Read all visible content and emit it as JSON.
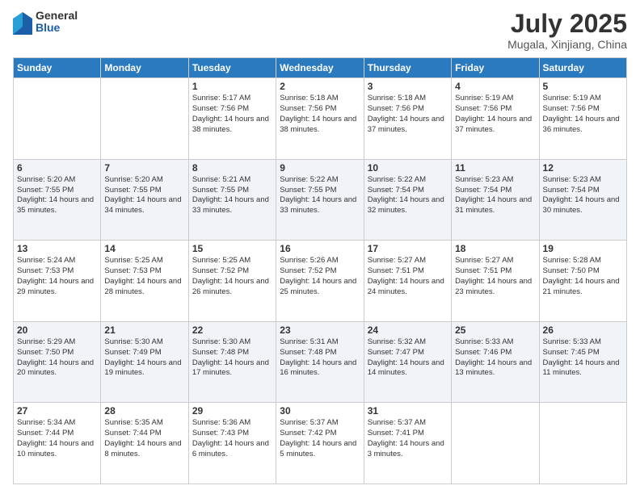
{
  "logo": {
    "general": "General",
    "blue": "Blue"
  },
  "title": "July 2025",
  "location": "Mugala, Xinjiang, China",
  "days": [
    "Sunday",
    "Monday",
    "Tuesday",
    "Wednesday",
    "Thursday",
    "Friday",
    "Saturday"
  ],
  "weeks": [
    [
      {
        "date": "",
        "info": ""
      },
      {
        "date": "",
        "info": ""
      },
      {
        "date": "1",
        "sunrise": "Sunrise: 5:17 AM",
        "sunset": "Sunset: 7:56 PM",
        "daylight": "Daylight: 14 hours and 38 minutes."
      },
      {
        "date": "2",
        "sunrise": "Sunrise: 5:18 AM",
        "sunset": "Sunset: 7:56 PM",
        "daylight": "Daylight: 14 hours and 38 minutes."
      },
      {
        "date": "3",
        "sunrise": "Sunrise: 5:18 AM",
        "sunset": "Sunset: 7:56 PM",
        "daylight": "Daylight: 14 hours and 37 minutes."
      },
      {
        "date": "4",
        "sunrise": "Sunrise: 5:19 AM",
        "sunset": "Sunset: 7:56 PM",
        "daylight": "Daylight: 14 hours and 37 minutes."
      },
      {
        "date": "5",
        "sunrise": "Sunrise: 5:19 AM",
        "sunset": "Sunset: 7:56 PM",
        "daylight": "Daylight: 14 hours and 36 minutes."
      }
    ],
    [
      {
        "date": "6",
        "sunrise": "Sunrise: 5:20 AM",
        "sunset": "Sunset: 7:55 PM",
        "daylight": "Daylight: 14 hours and 35 minutes."
      },
      {
        "date": "7",
        "sunrise": "Sunrise: 5:20 AM",
        "sunset": "Sunset: 7:55 PM",
        "daylight": "Daylight: 14 hours and 34 minutes."
      },
      {
        "date": "8",
        "sunrise": "Sunrise: 5:21 AM",
        "sunset": "Sunset: 7:55 PM",
        "daylight": "Daylight: 14 hours and 33 minutes."
      },
      {
        "date": "9",
        "sunrise": "Sunrise: 5:22 AM",
        "sunset": "Sunset: 7:55 PM",
        "daylight": "Daylight: 14 hours and 33 minutes."
      },
      {
        "date": "10",
        "sunrise": "Sunrise: 5:22 AM",
        "sunset": "Sunset: 7:54 PM",
        "daylight": "Daylight: 14 hours and 32 minutes."
      },
      {
        "date": "11",
        "sunrise": "Sunrise: 5:23 AM",
        "sunset": "Sunset: 7:54 PM",
        "daylight": "Daylight: 14 hours and 31 minutes."
      },
      {
        "date": "12",
        "sunrise": "Sunrise: 5:23 AM",
        "sunset": "Sunset: 7:54 PM",
        "daylight": "Daylight: 14 hours and 30 minutes."
      }
    ],
    [
      {
        "date": "13",
        "sunrise": "Sunrise: 5:24 AM",
        "sunset": "Sunset: 7:53 PM",
        "daylight": "Daylight: 14 hours and 29 minutes."
      },
      {
        "date": "14",
        "sunrise": "Sunrise: 5:25 AM",
        "sunset": "Sunset: 7:53 PM",
        "daylight": "Daylight: 14 hours and 28 minutes."
      },
      {
        "date": "15",
        "sunrise": "Sunrise: 5:25 AM",
        "sunset": "Sunset: 7:52 PM",
        "daylight": "Daylight: 14 hours and 26 minutes."
      },
      {
        "date": "16",
        "sunrise": "Sunrise: 5:26 AM",
        "sunset": "Sunset: 7:52 PM",
        "daylight": "Daylight: 14 hours and 25 minutes."
      },
      {
        "date": "17",
        "sunrise": "Sunrise: 5:27 AM",
        "sunset": "Sunset: 7:51 PM",
        "daylight": "Daylight: 14 hours and 24 minutes."
      },
      {
        "date": "18",
        "sunrise": "Sunrise: 5:27 AM",
        "sunset": "Sunset: 7:51 PM",
        "daylight": "Daylight: 14 hours and 23 minutes."
      },
      {
        "date": "19",
        "sunrise": "Sunrise: 5:28 AM",
        "sunset": "Sunset: 7:50 PM",
        "daylight": "Daylight: 14 hours and 21 minutes."
      }
    ],
    [
      {
        "date": "20",
        "sunrise": "Sunrise: 5:29 AM",
        "sunset": "Sunset: 7:50 PM",
        "daylight": "Daylight: 14 hours and 20 minutes."
      },
      {
        "date": "21",
        "sunrise": "Sunrise: 5:30 AM",
        "sunset": "Sunset: 7:49 PM",
        "daylight": "Daylight: 14 hours and 19 minutes."
      },
      {
        "date": "22",
        "sunrise": "Sunrise: 5:30 AM",
        "sunset": "Sunset: 7:48 PM",
        "daylight": "Daylight: 14 hours and 17 minutes."
      },
      {
        "date": "23",
        "sunrise": "Sunrise: 5:31 AM",
        "sunset": "Sunset: 7:48 PM",
        "daylight": "Daylight: 14 hours and 16 minutes."
      },
      {
        "date": "24",
        "sunrise": "Sunrise: 5:32 AM",
        "sunset": "Sunset: 7:47 PM",
        "daylight": "Daylight: 14 hours and 14 minutes."
      },
      {
        "date": "25",
        "sunrise": "Sunrise: 5:33 AM",
        "sunset": "Sunset: 7:46 PM",
        "daylight": "Daylight: 14 hours and 13 minutes."
      },
      {
        "date": "26",
        "sunrise": "Sunrise: 5:33 AM",
        "sunset": "Sunset: 7:45 PM",
        "daylight": "Daylight: 14 hours and 11 minutes."
      }
    ],
    [
      {
        "date": "27",
        "sunrise": "Sunrise: 5:34 AM",
        "sunset": "Sunset: 7:44 PM",
        "daylight": "Daylight: 14 hours and 10 minutes."
      },
      {
        "date": "28",
        "sunrise": "Sunrise: 5:35 AM",
        "sunset": "Sunset: 7:44 PM",
        "daylight": "Daylight: 14 hours and 8 minutes."
      },
      {
        "date": "29",
        "sunrise": "Sunrise: 5:36 AM",
        "sunset": "Sunset: 7:43 PM",
        "daylight": "Daylight: 14 hours and 6 minutes."
      },
      {
        "date": "30",
        "sunrise": "Sunrise: 5:37 AM",
        "sunset": "Sunset: 7:42 PM",
        "daylight": "Daylight: 14 hours and 5 minutes."
      },
      {
        "date": "31",
        "sunrise": "Sunrise: 5:37 AM",
        "sunset": "Sunset: 7:41 PM",
        "daylight": "Daylight: 14 hours and 3 minutes."
      },
      {
        "date": "",
        "info": ""
      },
      {
        "date": "",
        "info": ""
      }
    ]
  ]
}
